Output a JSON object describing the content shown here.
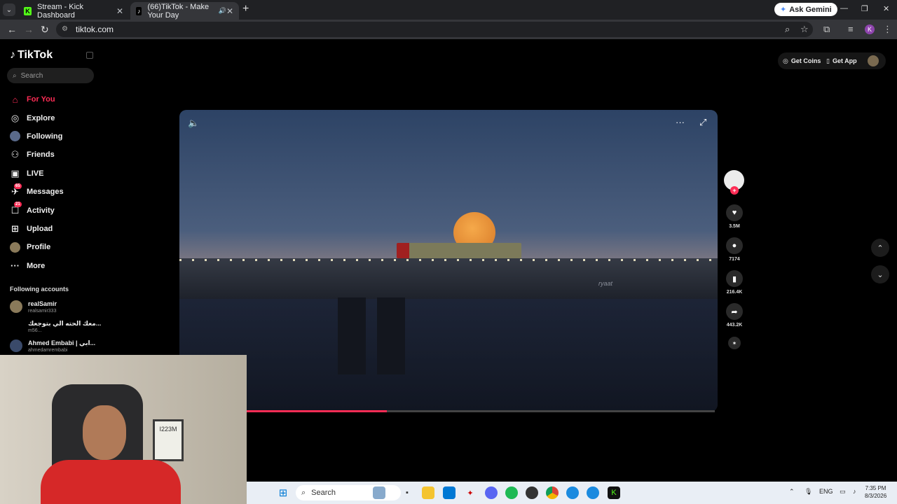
{
  "browser": {
    "tabs": [
      {
        "title": "Stream - Kick Dashboard",
        "favicon": "K"
      },
      {
        "title": "(66)TikTok - Make Your Day",
        "favicon": "♪"
      }
    ],
    "url": "tiktok.com",
    "gemini_label": "Ask Gemini",
    "profile_initial": "K"
  },
  "tiktok": {
    "logo": "TikTok",
    "search_placeholder": "Search",
    "nav": [
      {
        "label": "For You",
        "icon": "home-icon"
      },
      {
        "label": "Explore",
        "icon": "compass-icon"
      },
      {
        "label": "Following",
        "icon": "following-icon"
      },
      {
        "label": "Friends",
        "icon": "friends-icon"
      },
      {
        "label": "LIVE",
        "icon": "live-icon"
      },
      {
        "label": "Messages",
        "icon": "messages-icon",
        "badge": "65"
      },
      {
        "label": "Activity",
        "icon": "activity-icon",
        "badge": "21"
      },
      {
        "label": "Upload",
        "icon": "upload-icon"
      },
      {
        "label": "Profile",
        "icon": "profile-icon"
      },
      {
        "label": "More",
        "icon": "more-icon"
      }
    ],
    "following_title": "Following accounts",
    "accounts": [
      {
        "name": "realSamir",
        "handle": "realsamir333"
      },
      {
        "name": "معك الحته الي بتوجعك...",
        "handle": "m56..."
      },
      {
        "name": "Ahmed Embabi | ابي...",
        "handle": "ahmedamrembabi"
      }
    ],
    "header": {
      "get_coins": "Get Coins",
      "get_app": "Get App"
    },
    "video": {
      "progress": 0.3,
      "watermark": "ryaat"
    },
    "actions": {
      "likes": "3.5M",
      "comments": "7174",
      "saves": "216.4K",
      "shares": "443.2K"
    }
  },
  "webcam": {
    "frame_text": "I223M"
  },
  "taskbar": {
    "search_placeholder": "Search",
    "language": "ENG",
    "time": "7:35 PM",
    "date": "8/3/2026"
  },
  "colors": {
    "accent": "#fe2c55",
    "taskbar": "#e9eef5"
  }
}
